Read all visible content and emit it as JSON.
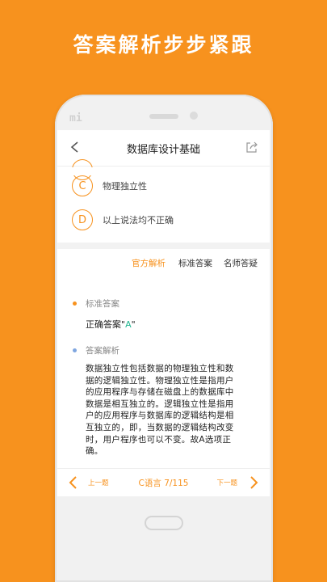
{
  "promo": {
    "headline": "答案解析步步紧跟"
  },
  "device": {
    "brand_logo": "mi"
  },
  "header": {
    "title": "数据库设计基础"
  },
  "options": [
    {
      "letter": "C",
      "text": "物理独立性"
    },
    {
      "letter": "D",
      "text": "以上说法均不正确"
    }
  ],
  "tabs": [
    {
      "label": "官方解析",
      "active": true
    },
    {
      "label": "标准答案",
      "active": false
    },
    {
      "label": "名师答疑",
      "active": false
    }
  ],
  "standard_answer": {
    "heading": "标准答案",
    "prefix": "正确答案",
    "open_quote": "\"",
    "value": "A",
    "close_quote": "\""
  },
  "analysis": {
    "heading": "答案解析",
    "lines": [
      "数据独立性包括数据的物理独立性和数",
      "据的逻辑独立性。物理独立性是指用户",
      "的应用程序与存储在磁盘上的数据库中",
      "数据是相互独立的。逻辑独立性是指用",
      "户的应用程序与数据库的逻辑结构是相",
      "互独立的，即，当数据的逻辑结构改变",
      "时，用户程序也可以不变。故A选项正",
      "确。"
    ]
  },
  "footer": {
    "prev_label": "上一题",
    "progress": "C语言 7/115",
    "next_label": "下一题"
  },
  "colors": {
    "accent": "#F7921E",
    "answer": "#1fb58f",
    "dot_orange": "#F7921E",
    "dot_blue": "#7fa6e0"
  },
  "icons": {
    "back": "chevron-left-icon",
    "share": "share-icon",
    "prev": "chevron-left-icon",
    "next": "chevron-right-icon"
  }
}
